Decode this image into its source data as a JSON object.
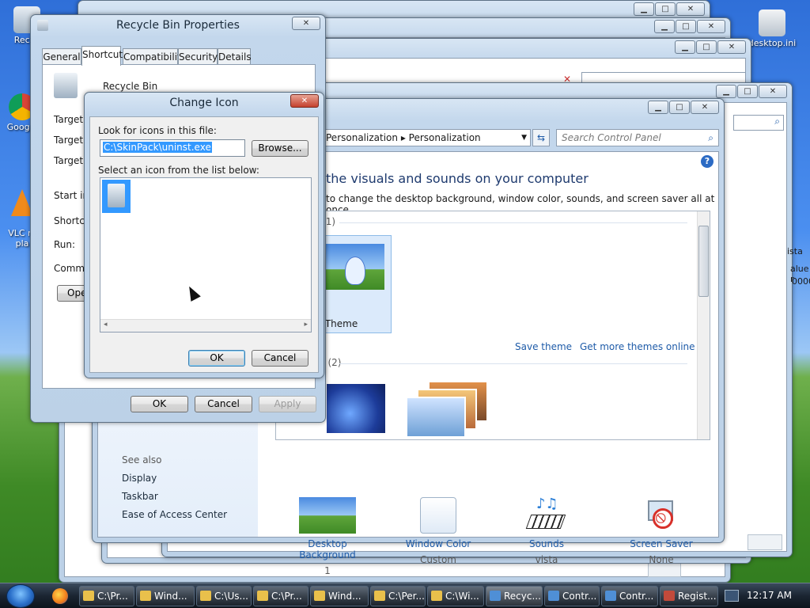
{
  "desktop": {
    "icons": [
      {
        "label": "Recyc"
      },
      {
        "label": "Google"
      },
      {
        "label": "VLC m\npla"
      },
      {
        "label": "desktop.ini"
      }
    ]
  },
  "control_panel": {
    "breadcrumb_prev": "Personalization",
    "breadcrumb_current": "Personalization",
    "search_placeholder": "Search Control Panel",
    "heading": "the visuals and sounds on your computer",
    "subheading": "to change the desktop background, window color, sounds, and screen saver all at once.",
    "themes_group_1": "s (1)",
    "theme_name": "ed Theme",
    "save_theme": "Save theme",
    "more_themes": "Get more themes online",
    "themes_group_2": "es (2)",
    "see_also": "See also",
    "see_also_links": [
      "Display",
      "Taskbar",
      "Ease of Access Center"
    ],
    "bottom_items": [
      {
        "label": "Desktop Background",
        "sub": "1"
      },
      {
        "label": "Window Color",
        "sub": "Custom"
      },
      {
        "label": "Sounds",
        "sub": "vista"
      },
      {
        "label": "Screen Saver",
        "sub": "None"
      }
    ]
  },
  "back_window": {
    "col_text": "ista",
    "row1": "alue r",
    "row2": "0000"
  },
  "recycle_props": {
    "title": "Recycle Bin Properties",
    "tabs": [
      "General",
      "Shortcut",
      "Compatibility",
      "Security",
      "Details"
    ],
    "name": "Recycle Bin",
    "labels": [
      "Target ty",
      "Target lo",
      "Target:",
      "Start in:",
      "Shortcut",
      "Run:",
      "Comme"
    ],
    "open_button": "Ope",
    "ok": "OK",
    "cancel": "Cancel",
    "apply": "Apply"
  },
  "change_icon": {
    "title": "Change Icon",
    "look_label": "Look for icons in this file:",
    "file_value": "C:\\SkinPack\\uninst.exe",
    "browse": "Browse...",
    "select_label": "Select an icon from the list below:",
    "ok": "OK",
    "cancel": "Cancel"
  },
  "taskbar": {
    "items": [
      "C:\\Pr...",
      "Wind...",
      "C:\\Us...",
      "C:\\Pr...",
      "Wind...",
      "C:\\Per...",
      "C:\\Wi...",
      "Recyc...",
      "Contr...",
      "Contr...",
      "Regist..."
    ],
    "clock": "12:17 AM"
  },
  "colors": {
    "link": "#1e5ba8",
    "heading": "#1e3a6e",
    "selection": "#3399ff"
  }
}
